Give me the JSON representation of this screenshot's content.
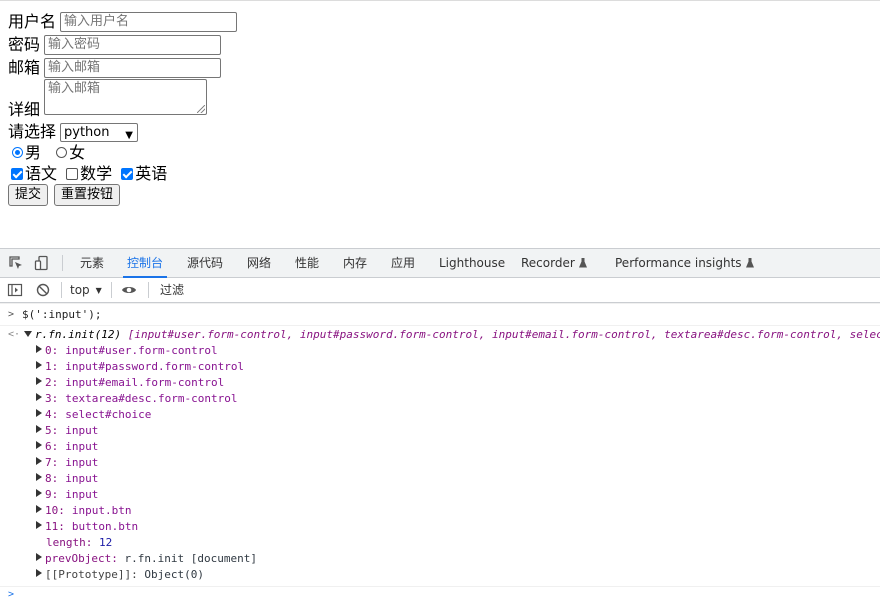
{
  "form": {
    "username_label": "用户名",
    "username_placeholder": "输入用户名",
    "password_label": "密码",
    "password_placeholder": "输入密码",
    "email_label": "邮箱",
    "email_placeholder": "输入邮箱",
    "detail_label": "详细",
    "detail_placeholder": "输入邮箱",
    "choice_label": "请选择",
    "choice_selected": "python",
    "gender": [
      {
        "label": "男",
        "checked": true
      },
      {
        "label": "女",
        "checked": false
      }
    ],
    "subjects": [
      {
        "label": "语文",
        "checked": true
      },
      {
        "label": "数学",
        "checked": false
      },
      {
        "label": "英语",
        "checked": true
      }
    ],
    "submit_label": "提交",
    "reset_label": "重置按钮"
  },
  "devtools": {
    "tabs": [
      "元素",
      "控制台",
      "源代码",
      "网络",
      "性能",
      "内存",
      "应用",
      "Lighthouse",
      "Recorder",
      "Performance insights"
    ],
    "active_tab": "控制台",
    "context": "top",
    "filter_placeholder": "过滤",
    "console": {
      "command": "$(':input');",
      "result_head": "r.fn.init(12)",
      "result_preview": "[input#user.form-control, input#password.form-control, input#email.form-control, textarea#desc.form-control, selec",
      "items": [
        {
          "key": "0:",
          "value": "input#user.form-control"
        },
        {
          "key": "1:",
          "value": "input#password.form-control"
        },
        {
          "key": "2:",
          "value": "input#email.form-control"
        },
        {
          "key": "3:",
          "value": "textarea#desc.form-control"
        },
        {
          "key": "4:",
          "value": "select#choice"
        },
        {
          "key": "5:",
          "value": "input"
        },
        {
          "key": "6:",
          "value": "input"
        },
        {
          "key": "7:",
          "value": "input"
        },
        {
          "key": "8:",
          "value": "input"
        },
        {
          "key": "9:",
          "value": "input"
        },
        {
          "key": "10:",
          "value": "input.btn"
        },
        {
          "key": "11:",
          "value": "button.btn"
        }
      ],
      "length_key": "length:",
      "length_value": "12",
      "prevobject_key": "prevObject:",
      "prevobject_value": "r.fn.init [document]",
      "prototype_key": "[[Prototype]]:",
      "prototype_value": "Object(0)"
    }
  }
}
